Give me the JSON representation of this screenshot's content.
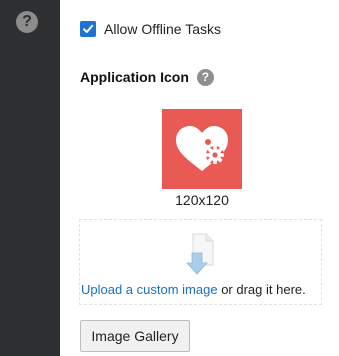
{
  "sidebar": {
    "help_glyph": "?",
    "help_icon": "question-circle-icon"
  },
  "settings": {
    "allow_offline": {
      "label": "Allow Offline Tasks",
      "checked": true
    }
  },
  "application_icon": {
    "title": "Application Icon",
    "help_glyph": "?",
    "icon_name": "heart-gear-icon",
    "icon_bg_color": "#e95a55",
    "size_label": "120x120"
  },
  "upload": {
    "link_text": "Upload a custom image",
    "suffix_text": " or drag it here.",
    "icon_name": "document-download-icon"
  },
  "gallery_button": {
    "label": "Image Gallery"
  },
  "colors": {
    "accent": "#1e73d2",
    "link": "#1a6fc2",
    "sidebar": "#2e2f31"
  }
}
